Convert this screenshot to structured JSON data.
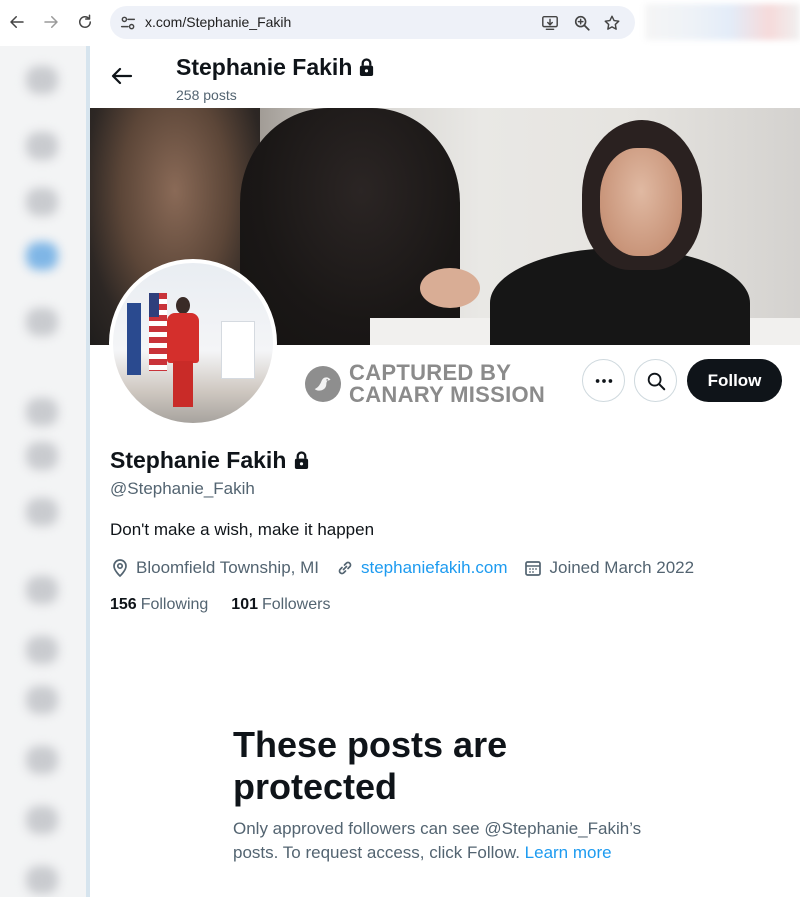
{
  "browser": {
    "url": "x.com/Stephanie_Fakih",
    "icons": [
      "back-arrow-icon",
      "forward-arrow-icon",
      "reload-icon",
      "site-info-icon",
      "install-app-icon",
      "zoom-icon",
      "bookmark-star-icon"
    ]
  },
  "header": {
    "name": "Stephanie Fakih",
    "posts": "258 posts"
  },
  "watermark": {
    "line1": "CAPTURED BY",
    "line2": "CANARY MISSION"
  },
  "actions": {
    "more_label": "More",
    "follow_label": "Follow"
  },
  "profile": {
    "name": "Stephanie Fakih",
    "handle": "@Stephanie_Fakih",
    "bio": "Don't make a wish, make it happen",
    "location": "Bloomfield Township, MI",
    "website": "stephaniefakih.com",
    "joined": "Joined March 2022",
    "following_count": "156",
    "following_label": "Following",
    "followers_count": "101",
    "followers_label": "Followers"
  },
  "protected": {
    "title": "These posts are protected",
    "body": "Only approved followers can see @Stephanie_Fakih’s posts. To request access, click Follow.",
    "learn_more": "Learn more"
  },
  "colors": {
    "accent": "#1d9bf0",
    "text_primary": "#0f1419",
    "text_secondary": "#536471",
    "follow_bg": "#0f1419"
  }
}
